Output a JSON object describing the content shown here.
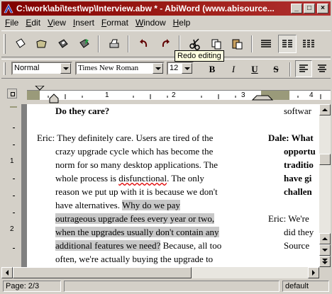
{
  "window": {
    "title": "C:\\work\\abi\\test\\wp\\Interview.abw * - AbiWord (www.abisource...",
    "min_label": "_",
    "max_label": "□",
    "close_label": "×"
  },
  "menu": [
    "File",
    "Edit",
    "View",
    "Insert",
    "Format",
    "Window",
    "Help"
  ],
  "tooltip": "Redo editing",
  "format_bar": {
    "style": "Normal",
    "font": "Times New Roman",
    "size": "12",
    "bold": "B",
    "italic": "I",
    "underline": "U",
    "strike": "S"
  },
  "ruler": {
    "numbers": [
      "1",
      "2",
      "3",
      "4"
    ]
  },
  "vruler": {
    "numbers": [
      "1",
      "2"
    ]
  },
  "document": {
    "col1": {
      "heading": "Do they care?",
      "lines": [
        "Eric: They definitely care. Users are tired of the",
        "crazy upgrade cycle which has become the",
        "norm for so many desktop applications. The",
        "whole process is ",
        "disfunctional",
        ". The only",
        "reason we put up with it is because we don't",
        "have alternatives. ",
        "Why do we pay",
        "outrageous upgrade fees every year or two,",
        "when the upgrades usually don't contain any",
        "additional features we need?",
        " Because, all too",
        "often, we're actually buying the upgrade to"
      ]
    },
    "col2": {
      "top": "softwar",
      "bold_lines": [
        "Dale: What",
        "opportu",
        "traditio",
        "have gi",
        "challen"
      ],
      "lines": [
        "Eric: We're",
        "did they",
        "Source"
      ]
    }
  },
  "status": {
    "page": "Page: 2/3",
    "mode": "default"
  }
}
